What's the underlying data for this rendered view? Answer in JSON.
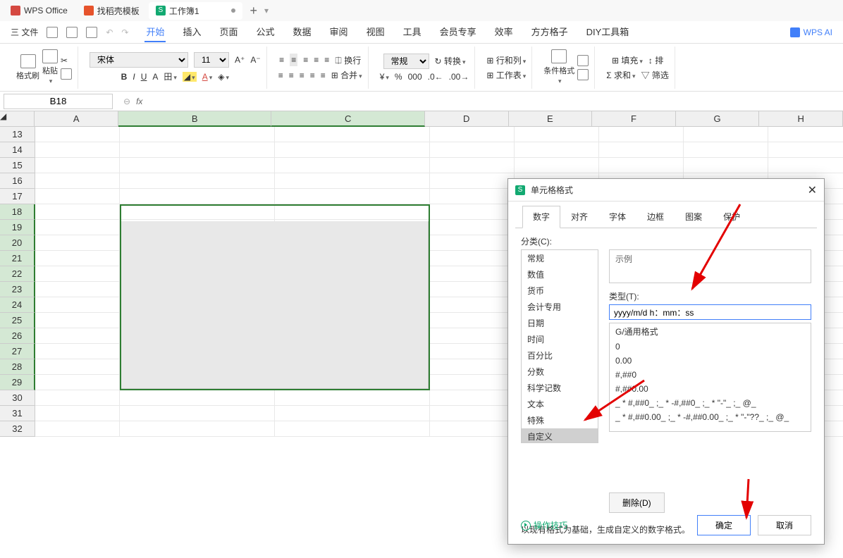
{
  "titlebar": {
    "tab1": "WPS Office",
    "tab2": "找稻壳模板",
    "tab3": "工作簿1",
    "sheet_icon": "S"
  },
  "menu": {
    "file": "三 文件",
    "tabs": [
      "开始",
      "插入",
      "页面",
      "公式",
      "数据",
      "审阅",
      "视图",
      "工具",
      "会员专享",
      "效率",
      "方方格子",
      "DIY工具箱"
    ],
    "ai": "WPS AI"
  },
  "ribbon": {
    "format_brush": "格式刷",
    "paste": "粘贴",
    "font_name": "宋体",
    "font_size": "11",
    "wrap": "换行",
    "merge": "合并",
    "general": "常规",
    "convert": "转换",
    "rows_cols": "行和列",
    "worksheet": "工作表",
    "cond_format": "条件格式",
    "fill": "填充",
    "sum": "求和",
    "sort": "排",
    "filter": "筛选"
  },
  "formula": {
    "name_box": "B18",
    "fx": "fx"
  },
  "grid": {
    "cols": [
      "A",
      "B",
      "C",
      "D",
      "E",
      "F",
      "G",
      "H"
    ],
    "row_start": 13,
    "row_end": 32
  },
  "dialog": {
    "title": "单元格格式",
    "tabs": [
      "数字",
      "对齐",
      "字体",
      "边框",
      "图案",
      "保护"
    ],
    "category_label": "分类(C):",
    "categories": [
      "常规",
      "数值",
      "货币",
      "会计专用",
      "日期",
      "时间",
      "百分比",
      "分数",
      "科学记数",
      "文本",
      "特殊",
      "自定义"
    ],
    "example_label": "示例",
    "type_label": "类型(T):",
    "type_value": "yyyy/m/d h：mm：ss",
    "formats": [
      "G/通用格式",
      "0",
      "0.00",
      "#,##0",
      "#,##0.00",
      "_ * #,##0_ ;_ * -#,##0_ ;_ * \"-\"_ ;_ @_",
      "_ * #,##0.00_ ;_ * -#,##0.00_ ;_ * \"-\"??_ ;_ @_"
    ],
    "delete_btn": "删除(D)",
    "desc": "以现有格式为基础，生成自定义的数字格式。",
    "tips": "操作技巧",
    "ok": "确定",
    "cancel": "取消"
  }
}
